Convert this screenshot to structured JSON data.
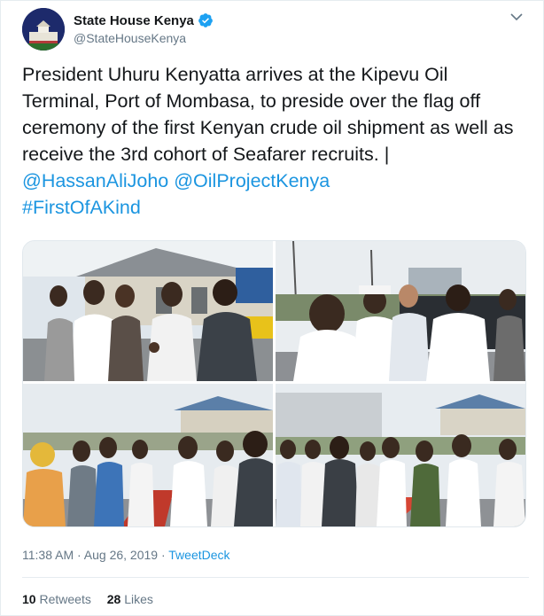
{
  "account": {
    "name": "State House Kenya",
    "handle": "@StateHouseKenya",
    "verified": true
  },
  "tweet": {
    "text": "President Uhuru Kenyatta arrives at the Kipevu Oil Terminal, Port of Mombasa, to preside over the flag off ceremony of the first Kenyan crude oil shipment as well as receive the 3rd cohort of Seafarer recruits. |",
    "mention1": "@HassanAliJoho",
    "mention2": "@OilProjectKenya",
    "hashtag": "#FirstOfAKind"
  },
  "meta": {
    "time": "11:38 AM · Aug 26, 2019 · ",
    "source": "TweetDeck"
  },
  "stats": {
    "retweets_count": "10",
    "retweets_label": "Retweets",
    "likes_count": "28",
    "likes_label": "Likes"
  },
  "colors": {
    "link": "#1b95e0",
    "verified": "#1da1f2",
    "secondary_text": "#657786"
  }
}
